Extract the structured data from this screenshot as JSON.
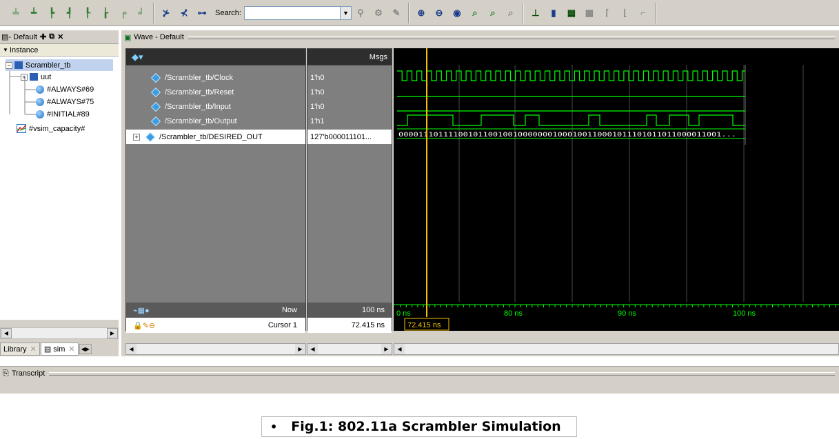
{
  "toolbar": {
    "search_label": "Search:",
    "search_value": ""
  },
  "left_pane": {
    "header_label": "- Default",
    "column_header": "Instance",
    "tree": [
      {
        "label": "Scrambler_tb",
        "icon": "module-icon"
      },
      {
        "label": "uut",
        "icon": "module-icon"
      },
      {
        "label": "#ALWAYS#69",
        "icon": "process-icon"
      },
      {
        "label": "#ALWAYS#75",
        "icon": "process-icon"
      },
      {
        "label": "#INITIAL#89",
        "icon": "process-icon"
      },
      {
        "label": "#vsim_capacity#",
        "icon": "capacity-icon"
      }
    ],
    "tabs": [
      {
        "label": "Library"
      },
      {
        "label": "sim"
      }
    ]
  },
  "wave": {
    "title": "Wave - Default",
    "msgs_header": "Msgs",
    "signals": [
      {
        "name": "/Scrambler_tb/Clock",
        "value": "1'h0"
      },
      {
        "name": "/Scrambler_tb/Reset",
        "value": "1'h0"
      },
      {
        "name": "/Scrambler_tb/Input",
        "value": "1'h0"
      },
      {
        "name": "/Scrambler_tb/Output",
        "value": "1'h1"
      },
      {
        "name": "/Scrambler_tb/DESIRED_OUT",
        "value": "127'b000011101..."
      }
    ],
    "bus_text": "00001110111100101100100100000001000100110001011101011011000011001...",
    "now_label": "Now",
    "now_value": "100 ns",
    "cursor_label": "Cursor 1",
    "cursor_value": "72.415 ns",
    "cursor_flag": "72.415 ns",
    "time_ticks": [
      "0 ns",
      "80 ns",
      "90 ns",
      "100 ns"
    ]
  },
  "transcript": {
    "title": "Transcript"
  },
  "caption": {
    "bullet": "•",
    "text": "Fig.1: 802.11a Scrambler Simulation"
  },
  "colors": {
    "wave_green": "#00ff00",
    "cursor_yellow": "#f2c200",
    "grid_gray": "#555555"
  }
}
